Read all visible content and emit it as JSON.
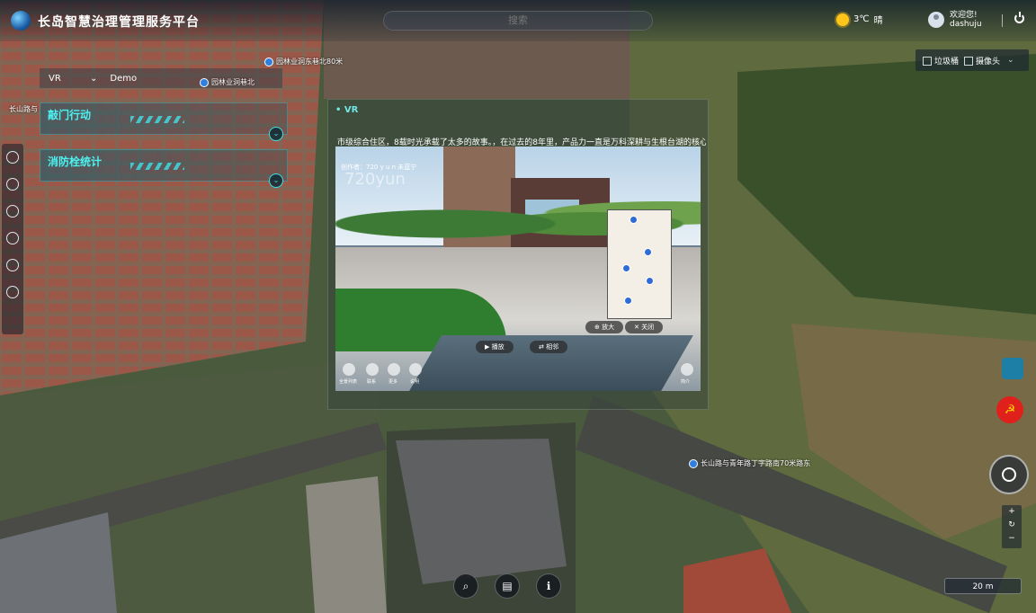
{
  "app": {
    "title": "长岛智慧治理管理服务平台"
  },
  "search": {
    "placeholder": "搜索"
  },
  "weather": {
    "temp": "3℃",
    "condition": "晴"
  },
  "user": {
    "greeting": "欢迎您!",
    "name": "dashuju"
  },
  "layers": [
    {
      "label": "垃圾桶"
    },
    {
      "label": "摄像头"
    }
  ],
  "vr_select": {
    "label": "VR",
    "value": "Demo"
  },
  "panels": [
    {
      "title": "敲门行动"
    },
    {
      "title": "消防栓统计"
    }
  ],
  "vr_panel": {
    "title": "• VR",
    "description": "市级综合住区，8载时光承载了太多的故事。，在过去的8年里，产品力一直是万科深耕与生根台湖的核心",
    "credit": "创作者：720 y u n 未蓝宁",
    "watermark": "720yun",
    "buttons": {
      "zoom": "⊕ 放大",
      "close": "✕ 关闭",
      "play": "▶ 播放",
      "share": "⇄ 相邻"
    },
    "bottom_icons": [
      "全景列表",
      "联系",
      "更多",
      "说明",
      "简介"
    ]
  },
  "street_labels": [
    "园林业洞东巷北80米",
    "园林业洞巷北",
    "长山路与青年路丁字路南70米路东",
    "长山路与"
  ],
  "scale": {
    "label": "20 m"
  },
  "colors": {
    "accent": "#3ee0e8",
    "party_red": "#e0201a",
    "sun": "#ffc51a"
  }
}
